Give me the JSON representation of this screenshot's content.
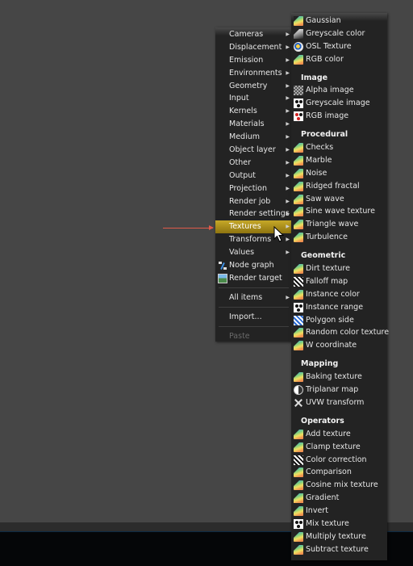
{
  "main_menu": {
    "items": [
      {
        "label": "Cameras",
        "submenu": true
      },
      {
        "label": "Displacement",
        "submenu": true
      },
      {
        "label": "Emission",
        "submenu": true
      },
      {
        "label": "Environments",
        "submenu": true
      },
      {
        "label": "Geometry",
        "submenu": true
      },
      {
        "label": "Input",
        "submenu": true
      },
      {
        "label": "Kernels",
        "submenu": true
      },
      {
        "label": "Materials",
        "submenu": true
      },
      {
        "label": "Medium",
        "submenu": true
      },
      {
        "label": "Object layer",
        "submenu": true
      },
      {
        "label": "Other",
        "submenu": true
      },
      {
        "label": "Output",
        "submenu": true
      },
      {
        "label": "Projection",
        "submenu": true
      },
      {
        "label": "Render job",
        "submenu": true
      },
      {
        "label": "Render settings",
        "submenu": true
      },
      {
        "label": "Textures",
        "submenu": true,
        "active": true
      },
      {
        "label": "Transforms",
        "submenu": true
      },
      {
        "label": "Values",
        "submenu": true
      },
      {
        "label": "Node graph",
        "icon": "node-graph-icon"
      },
      {
        "label": "Render target",
        "icon": "render-target-icon"
      }
    ],
    "all_items": "All items",
    "import": "Import...",
    "paste": "Paste",
    "arrow_glyph": "▶"
  },
  "textures_menu": {
    "top_items": [
      {
        "label": "Gaussian",
        "icon": "texture-gradient-icon"
      },
      {
        "label": "Greyscale color",
        "icon": "greyscale-icon"
      },
      {
        "label": "OSL Texture",
        "icon": "osl-icon"
      },
      {
        "label": "RGB color",
        "icon": "texture-gradient-icon"
      }
    ],
    "categories": [
      {
        "title": "Image",
        "items": [
          {
            "label": "Alpha image",
            "icon": "alpha-image-icon"
          },
          {
            "label": "Greyscale image",
            "icon": "greyscale-image-icon"
          },
          {
            "label": "RGB image",
            "icon": "rgb-image-icon"
          }
        ]
      },
      {
        "title": "Procedural",
        "items": [
          {
            "label": "Checks",
            "icon": "texture-gradient-icon"
          },
          {
            "label": "Marble",
            "icon": "texture-gradient-icon"
          },
          {
            "label": "Noise",
            "icon": "texture-gradient-icon"
          },
          {
            "label": "Ridged fractal",
            "icon": "texture-gradient-icon"
          },
          {
            "label": "Saw wave",
            "icon": "texture-gradient-icon"
          },
          {
            "label": "Sine wave texture",
            "icon": "texture-gradient-icon"
          },
          {
            "label": "Triangle wave",
            "icon": "texture-gradient-icon"
          },
          {
            "label": "Turbulence",
            "icon": "texture-gradient-icon"
          }
        ]
      },
      {
        "title": "Geometric",
        "items": [
          {
            "label": "Dirt texture",
            "icon": "texture-gradient-icon"
          },
          {
            "label": "Falloff map",
            "icon": "falloff-map-icon"
          },
          {
            "label": "Instance color",
            "icon": "texture-gradient-icon"
          },
          {
            "label": "Instance range",
            "icon": "greyscale-image-icon"
          },
          {
            "label": "Polygon side",
            "icon": "polygon-side-icon"
          },
          {
            "label": "Random color texture",
            "icon": "texture-gradient-icon"
          },
          {
            "label": "W coordinate",
            "icon": "texture-gradient-icon"
          }
        ]
      },
      {
        "title": "Mapping",
        "items": [
          {
            "label": "Baking texture",
            "icon": "texture-gradient-icon"
          },
          {
            "label": "Triplanar map",
            "icon": "triplanar-map-icon"
          },
          {
            "label": "UVW transform",
            "icon": "uvw-transform-icon"
          }
        ]
      },
      {
        "title": "Operators",
        "items": [
          {
            "label": "Add texture",
            "icon": "texture-gradient-icon"
          },
          {
            "label": "Clamp texture",
            "icon": "texture-gradient-icon"
          },
          {
            "label": "Color correction",
            "icon": "falloff-map-icon"
          },
          {
            "label": "Comparison",
            "icon": "texture-gradient-icon"
          },
          {
            "label": "Cosine mix texture",
            "icon": "texture-gradient-icon"
          },
          {
            "label": "Gradient",
            "icon": "gradient-icon"
          },
          {
            "label": "Invert",
            "icon": "texture-gradient-icon"
          },
          {
            "label": "Mix texture",
            "icon": "greyscale-image-icon"
          },
          {
            "label": "Multiply texture",
            "icon": "texture-gradient-icon"
          },
          {
            "label": "Subtract texture",
            "icon": "texture-gradient-icon"
          }
        ]
      }
    ]
  },
  "colors": {
    "background": "#464646",
    "menu_bg": "#232323",
    "active_highlight": "#b09320",
    "annotation_arrow": "#e05a4a"
  }
}
